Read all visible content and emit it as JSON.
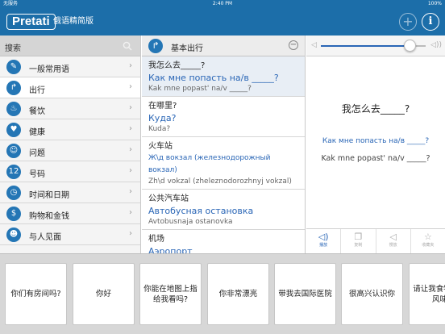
{
  "status": {
    "carrier": "无服务",
    "time": "2:40 PM",
    "battery": "100%"
  },
  "header": {
    "logo": "Pretati",
    "subtitle": "俄语精简版",
    "add_icon": "plus-icon",
    "info_icon": "info-icon",
    "info_glyph": "i",
    "add_glyph": "+"
  },
  "sidebar": {
    "search_label": "搜索",
    "items": [
      {
        "label": "一般常用语",
        "icon": "pen-icon",
        "glyph": "✎"
      },
      {
        "label": "出行",
        "icon": "turn-arrow-icon",
        "glyph": "↱"
      },
      {
        "label": "餐饮",
        "icon": "fork-icon",
        "glyph": "♨"
      },
      {
        "label": "健康",
        "icon": "cup-icon",
        "glyph": "♥"
      },
      {
        "label": "问题",
        "icon": "smile-icon",
        "glyph": "☺"
      },
      {
        "label": "号码",
        "icon": "numbers-icon",
        "glyph": "12"
      },
      {
        "label": "时间和日期",
        "icon": "clock-icon",
        "glyph": "◷"
      },
      {
        "label": "购物和金钱",
        "icon": "shopping-icon",
        "glyph": "$"
      },
      {
        "label": "与人见面",
        "icon": "people-icon",
        "glyph": "☻"
      }
    ],
    "chevron": "›"
  },
  "middle": {
    "title": "基本出行",
    "head_glyph": "↱",
    "minus_glyph": "−",
    "phrases": [
      {
        "zh": "我怎么去_____?",
        "ru": "Как мне попасть на/в _____?",
        "tr": "Kak mne popast' na/v _____?"
      },
      {
        "zh": "在哪里?",
        "ru": "Куда?",
        "tr": "Kuda?"
      },
      {
        "zh": "火车站",
        "ru": "Ж\\д вокзал (железнодорожный вокзал)",
        "tr": "Zh\\d vokzal (zheleznodorozhnyj vokzal)"
      },
      {
        "zh": "公共汽车站",
        "ru": "Автобусная остановка",
        "tr": "Avtobusnaja ostanovka"
      },
      {
        "zh": "机场",
        "ru": "Аэропорт",
        "tr": ""
      }
    ]
  },
  "detail": {
    "zh": "我怎么去_____?",
    "ru": "Как мне попасть на/в _____?",
    "tr": "Kak mne popast' na/v _____?",
    "volume": 0.85,
    "spk_low": "◁",
    "spk_high": "◁))",
    "tools": [
      {
        "label": "播放",
        "icon": "speaker-icon",
        "glyph": "◁)"
      },
      {
        "label": "复制",
        "icon": "copy-icon",
        "glyph": "❐"
      },
      {
        "label": "慢放",
        "icon": "slow-speaker-icon",
        "glyph": "◁"
      },
      {
        "label": "收藏夹",
        "icon": "star-icon",
        "glyph": "☆"
      }
    ]
  },
  "cards": [
    "你们有房间吗?",
    "你好",
    "你能在地图上指给我看吗?",
    "你非常漂亮",
    "带我去国际医院",
    "很高兴认识你",
    "请让我食物辛辣风味"
  ]
}
